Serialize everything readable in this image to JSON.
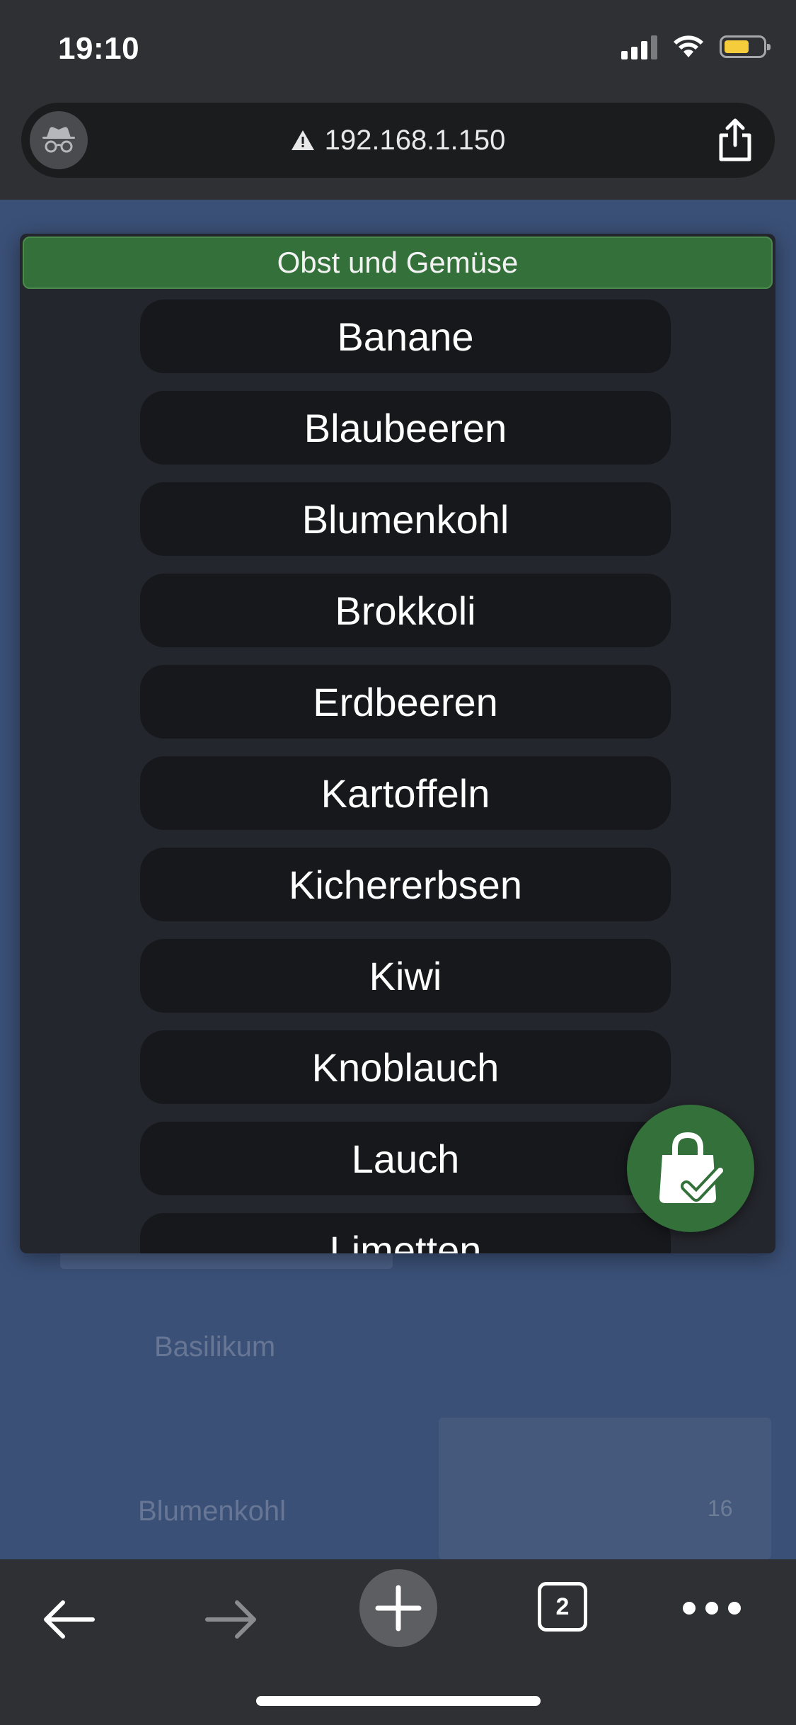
{
  "status_bar": {
    "time": "19:10"
  },
  "browser": {
    "url": "192.168.1.150",
    "tab_count": "2"
  },
  "background_page": {
    "item_basilikum": "Basilikum",
    "item_blumenkohl": "Blumenkohl",
    "count_badge": "16"
  },
  "modal": {
    "title": "Obst und Gemüse",
    "items": [
      "Banane",
      "Blaubeeren",
      "Blumenkohl",
      "Brokkoli",
      "Erdbeeren",
      "Kartoffeln",
      "Kichererbsen",
      "Kiwi",
      "Knoblauch",
      "Lauch",
      "Limetten"
    ]
  },
  "colors": {
    "accent_green": "#33703a",
    "modal_bg": "#24262d",
    "item_bg": "#17181c",
    "battery_yellow": "#f4cc3c"
  },
  "icons": {
    "fab": "shopping-bag-check-icon",
    "incognito": "incognito-icon",
    "warning": "warning-icon",
    "share": "share-icon",
    "back": "arrow-left-icon",
    "forward": "arrow-right-icon",
    "new_tab": "plus-icon",
    "tabs": "tabs-icon",
    "more": "more-icon"
  }
}
